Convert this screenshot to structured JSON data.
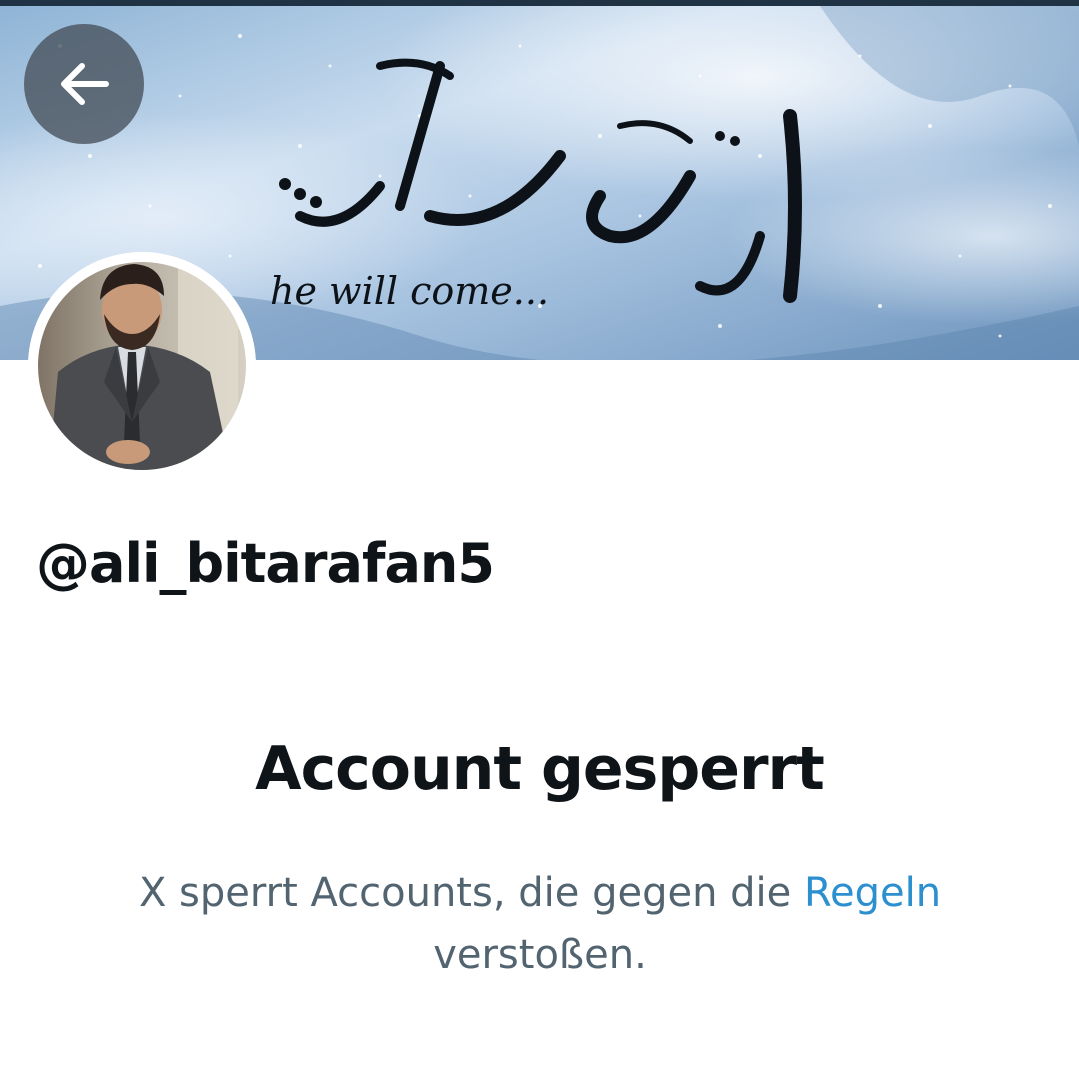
{
  "header": {
    "back_icon": "arrow-left-icon",
    "banner": {
      "caption_latin": "he will come...",
      "caption_persian": "او خواهد آمد..."
    }
  },
  "profile": {
    "avatar_icon": "profile-photo",
    "handle": "@ali_bitarafan5"
  },
  "notice": {
    "title": "Account gesperrt",
    "text_before_link": "X sperrt Accounts, die gegen die ",
    "link_label": "Regeln",
    "text_after_link": "verstoßen."
  },
  "colors": {
    "primary_text": "#0f1419",
    "secondary_text": "#536471",
    "link": "#2c8fcf"
  }
}
